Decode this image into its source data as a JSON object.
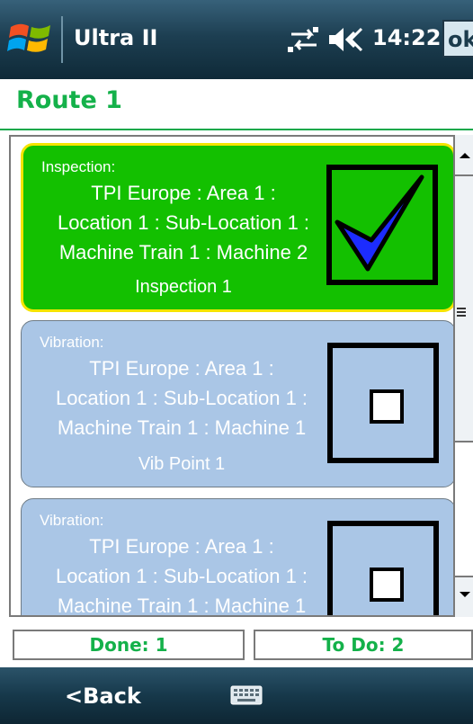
{
  "titlebar": {
    "app_title": "Ultra II",
    "time": "14:22",
    "ok_label": "ok"
  },
  "route": {
    "title": "Route 1"
  },
  "tasks": [
    {
      "type": "Inspection:",
      "path": [
        "TPI Europe : Area 1 :",
        "Location 1 : Sub-Location 1 :",
        "Machine Train 1 : Machine 2"
      ],
      "point": "Inspection 1",
      "status": "done"
    },
    {
      "type": "Vibration:",
      "path": [
        "TPI Europe : Area 1 :",
        "Location 1 : Sub-Location 1 :",
        "Machine Train 1 : Machine 1"
      ],
      "point": "Vib Point 1",
      "status": "todo"
    },
    {
      "type": "Vibration:",
      "path": [
        "TPI Europe : Area 1 :",
        "Location 1 : Sub-Location 1 :",
        "Machine Train 1 : Machine 1"
      ],
      "point": "",
      "status": "todo"
    }
  ],
  "status": {
    "done_label": "Done: 1",
    "todo_label": "To Do: 2"
  },
  "softkeys": {
    "back_label": "<Back"
  },
  "colors": {
    "accent_green": "#14b14a",
    "done_card": "#13c000",
    "todo_card": "#aac6e6",
    "done_border": "#f5e400",
    "check_blue": "#1c2cff"
  },
  "icons": [
    "windows-start-icon",
    "connectivity-icon",
    "volume-icon",
    "checkmark-icon",
    "keyboard-icon"
  ]
}
